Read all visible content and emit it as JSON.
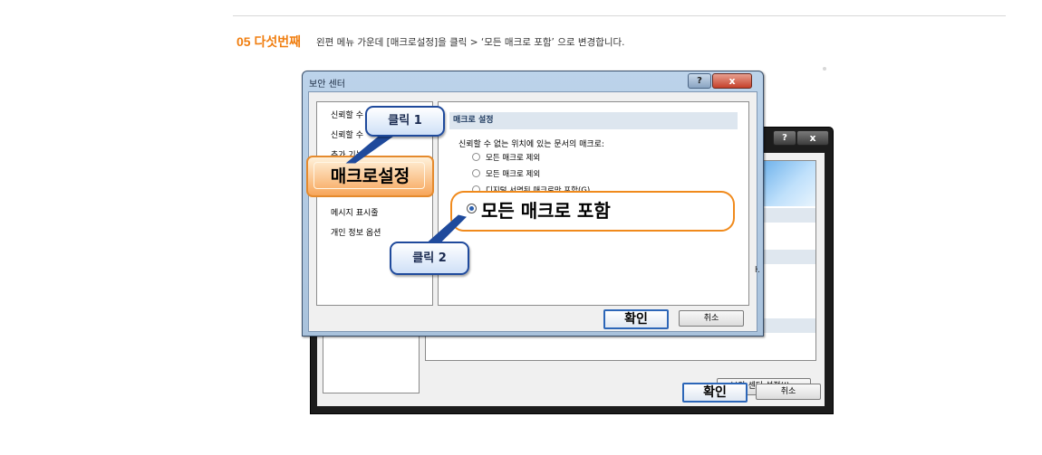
{
  "instruction": {
    "step_number": "05 다섯번째",
    "text": "왼편 메뉴 가운데 [매크로설정]을 클릭 > ‘모든 매크로 포함’ 으로 변경합니다."
  },
  "back_dialog": {
    "help_label": "?",
    "close_label": "x",
    "fragment": "ŀ.",
    "trust_center_button": "보안 센터 설정(I)...",
    "ok_label": "확인",
    "cancel_label": "취소"
  },
  "front_dialog": {
    "title": "보안 센터",
    "help_label": "?",
    "close_label": "x",
    "nav_items": [
      "신뢰할 수",
      "신뢰할 수",
      "추가 기능",
      "매크로설정",
      "메시지 표시줄",
      "개인 정보 옵션"
    ],
    "section_header": "매크로 설정",
    "intro": "신뢰할 수 없는 위치에 있는 문서의 매크로:",
    "options": [
      "모든 매크로 제외",
      "모든 매크로 제외",
      "디지털 서명된 매크로만 포함(G)",
      "모든 매크로 포함"
    ],
    "ok_label": "확인",
    "cancel_label": "취소"
  },
  "callouts": {
    "click1": "클릭 1",
    "click2": "클릭 2"
  },
  "colors": {
    "step_orange": "#f07e10",
    "callout_blue": "#1f4a9c",
    "highlight_orange": "#f08a1c"
  }
}
